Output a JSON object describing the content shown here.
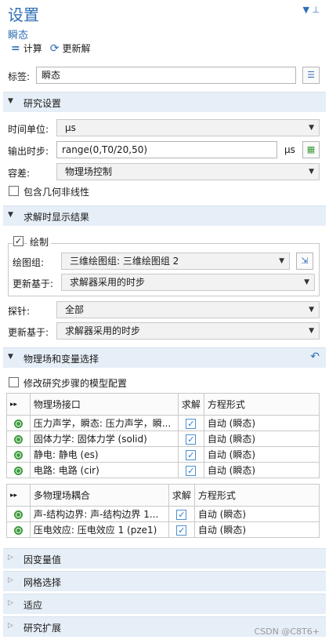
{
  "header": {
    "title": "设置",
    "subtitle": "瞬态",
    "compute_label": "计算",
    "update_solution_label": "更新解"
  },
  "label_field": {
    "label": "标签:",
    "value": "瞬态"
  },
  "study_settings": {
    "title": "研究设置",
    "time_unit_label": "时间单位:",
    "time_unit_value": "µs",
    "output_times_label": "输出时步:",
    "output_times_value": "range(0,T0/20,50)",
    "output_times_unit": "µs",
    "tolerance_label": "容差:",
    "tolerance_value": "物理场控制",
    "include_nonlinearity_label": "包含几何非线性"
  },
  "results_while_solving": {
    "title": "求解时显示结果",
    "plot_label": "绘制",
    "plot_group_label": "绘图组:",
    "plot_group_value": "三维绘图组: 三维绘图组 2",
    "update_at_label": "更新基于:",
    "update_at_value": "求解器采用的时步",
    "probes_label": "探针:",
    "probes_value": "全部",
    "probe_update_label": "更新基于:",
    "probe_update_value": "求解器采用的时步"
  },
  "physics_selection": {
    "title": "物理场和变量选择",
    "modify_label": "修改研究步骤的模型配置",
    "physics_table": {
      "headers": [
        "物理场接口",
        "求解",
        "方程形式"
      ],
      "rows": [
        {
          "name": "压力声学，瞬态: 压力声学，瞬...",
          "form": "自动 (瞬态)"
        },
        {
          "name": "固体力学: 固体力学 (solid)",
          "form": "自动 (瞬态)"
        },
        {
          "name": "静电: 静电 (es)",
          "form": "自动 (瞬态)"
        },
        {
          "name": "电路: 电路 (cir)",
          "form": "自动 (瞬态)"
        }
      ]
    },
    "multiphysics_table": {
      "headers": [
        "多物理场耦合",
        "求解",
        "方程形式"
      ],
      "rows": [
        {
          "name": "声-结构边界: 声-结构边界 1...",
          "form": "自动 (瞬态)"
        },
        {
          "name": "压电效应: 压电效应 1 (pze1)",
          "form": "自动 (瞬态)"
        }
      ]
    }
  },
  "collapsed_sections": {
    "dependent_variables": "因变量值",
    "mesh_selection": "网格选择",
    "adaptation": "适应",
    "study_extensions": "研究扩展"
  },
  "watermark": "CSDN @C8T6+",
  "colors": {
    "accent": "#2f6fb5",
    "section_bg": "#e6eef7",
    "active_green": "#3a9a3a"
  }
}
